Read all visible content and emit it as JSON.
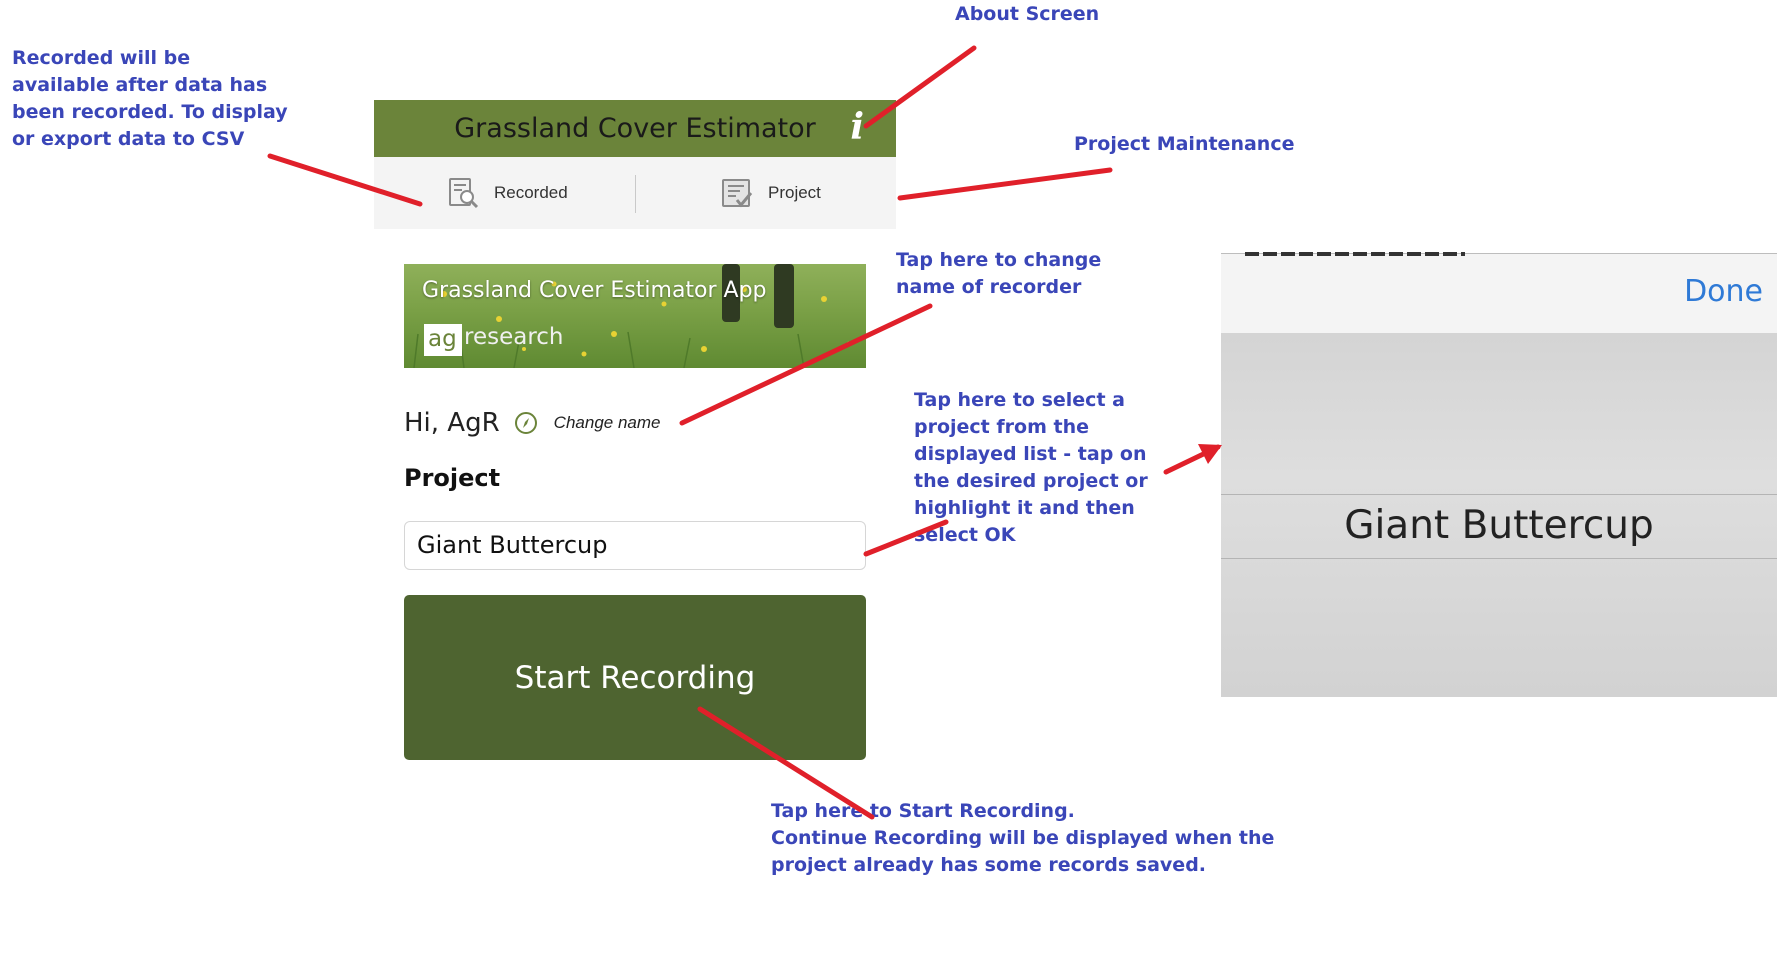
{
  "app": {
    "title": "Grassland Cover Estimator",
    "info_icon_glyph": "i",
    "tabs": [
      {
        "label": "Recorded",
        "icon": "recorded-search-icon"
      },
      {
        "label": "Project",
        "icon": "project-checklist-icon"
      }
    ],
    "banner": {
      "title": "Grassland Cover Estimator App",
      "logo_ag": "ag",
      "logo_rest": "research"
    },
    "greeting": "Hi, AgR",
    "change_name_label": "Change name",
    "project_label": "Project",
    "project_value": "Giant Buttercup",
    "start_button_label": "Start Recording"
  },
  "picker": {
    "done_label": "Done",
    "selected_value": "Giant Buttercup"
  },
  "annotations": {
    "about_screen": "About Screen",
    "recorded_note": "Recorded will be\navailable after data has\nbeen recorded. To display\nor export data to CSV",
    "project_maintenance": "Project Maintenance",
    "change_name_note": "Tap here to change\nname of recorder",
    "select_project_note": "Tap here to select a\nproject from the\ndisplayed list - tap on\nthe desired project or\nhighlight it and then\nselect OK",
    "start_recording_note": "Tap here to Start Recording.\nContinue Recording will be displayed when the\nproject already has  some records saved."
  },
  "colors": {
    "annotation_text": "#3a46b8",
    "arrow": "#e0202a",
    "title_bar": "#6b843a",
    "start_button": "#4e6430",
    "done": "#2f7ad6"
  }
}
